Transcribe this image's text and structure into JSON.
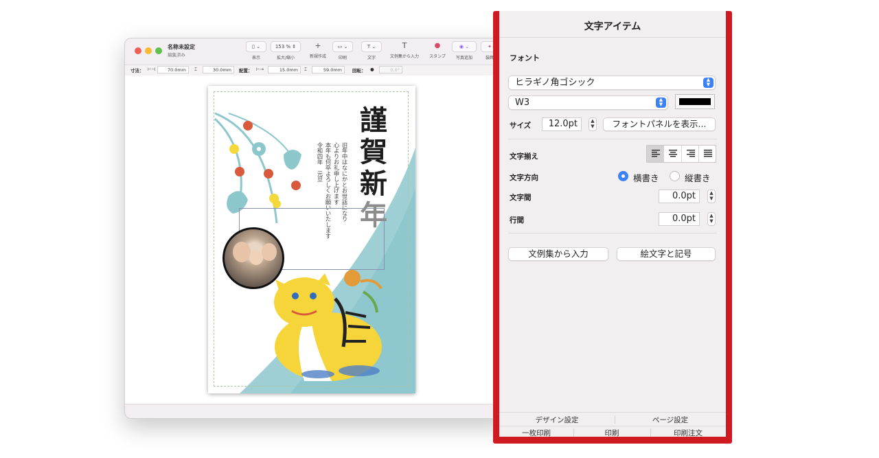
{
  "app_window": {
    "doc_title": "名称未設定",
    "doc_subtitle": "編集済み",
    "toolbar": [
      {
        "id": "view",
        "icon": "sidebar-icon",
        "text": "▯ ⌄",
        "label": "表示"
      },
      {
        "id": "zoom",
        "icon": "zoom-stepper",
        "text": "153 % ⇕",
        "label": "拡大/縮小"
      },
      {
        "id": "new",
        "icon": "plus-icon",
        "text": "+",
        "label": "新規作成"
      },
      {
        "id": "print",
        "icon": "printer-icon",
        "text": "▭ ⌄",
        "label": "印刷"
      },
      {
        "id": "text",
        "icon": "text-icon",
        "text": "T ⌄",
        "label": "文字"
      },
      {
        "id": "sample",
        "icon": "text-sample-icon",
        "text": "T",
        "label": "文例集から入力"
      },
      {
        "id": "stamp",
        "icon": "stamp-icon",
        "text": "●",
        "label": "スタンプ"
      },
      {
        "id": "photo",
        "icon": "photo-add-icon",
        "text": "◉ ⌄",
        "label": "写真追加"
      },
      {
        "id": "decorate",
        "icon": "magic-icon",
        "text": "✦",
        "label": "装飾"
      }
    ],
    "measure": {
      "size_label": "寸法：",
      "width": "70.0mm",
      "height": "30.0mm",
      "position_label": "配置：",
      "x": "15.0mm",
      "y": "59.0mm",
      "rotation_label": "回転：",
      "rotation": "0.0°"
    }
  },
  "postcard": {
    "title_chars": [
      "謹",
      "賀",
      "新",
      "年"
    ],
    "greeting_lines": [
      "旧年中はなにかとお世話になり",
      "心よりお礼申し上げます",
      "本年も何卒よろしくお願いいたします",
      "令和四年　元旦"
    ],
    "colors": {
      "wash": "#8cc7cc",
      "tiger_yellow": "#f5d53a",
      "ornament_red": "#d9593d",
      "ornament_yellow": "#f5d93b"
    }
  },
  "inspector": {
    "title": "文字アイテム",
    "font_section": "フォント",
    "font_family": "ヒラギノ角ゴシック",
    "font_weight": "W3",
    "font_color": "#000000",
    "size_label": "サイズ",
    "size_value": "12.0pt",
    "font_panel_button": "フォントパネルを表示...",
    "align_label": "文字揃え",
    "alignment_options": [
      "left",
      "center",
      "right",
      "justify"
    ],
    "alignment_selected": "left",
    "direction_label": "文字方向",
    "direction_horizontal": "横書き",
    "direction_vertical": "縦書き",
    "direction_selected": "horizontal",
    "letter_spacing_label": "文字間",
    "letter_spacing_value": "0.0pt",
    "line_spacing_label": "行間",
    "line_spacing_value": "0.0pt",
    "sample_button": "文例集から入力",
    "emoji_button": "絵文字と記号",
    "tabs_row1": [
      "デザイン設定",
      "ページ設定"
    ],
    "tabs_row2": [
      "一枚印刷",
      "印刷",
      "印刷注文"
    ]
  }
}
